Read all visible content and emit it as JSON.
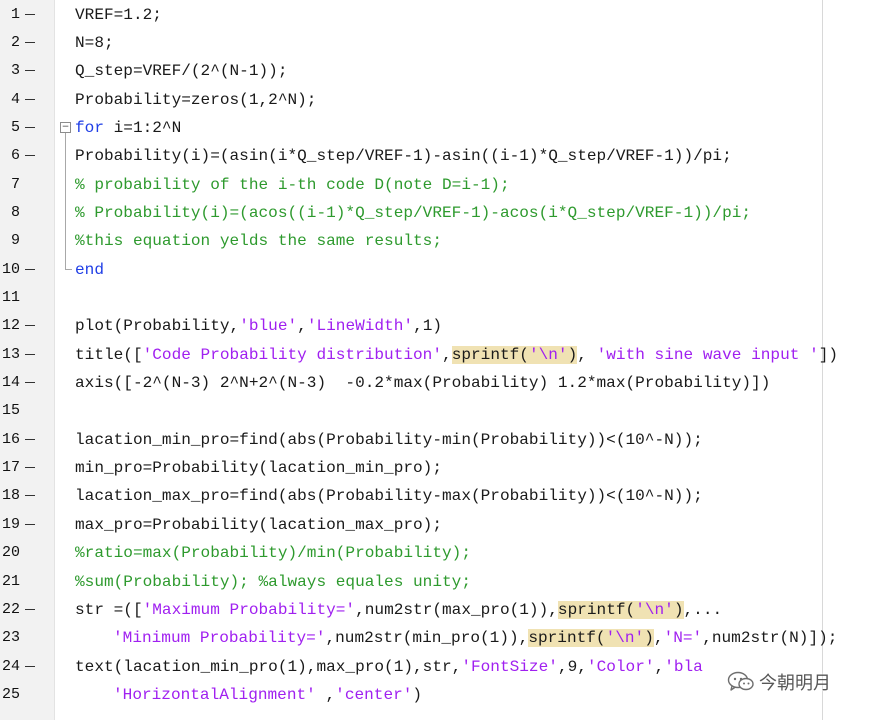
{
  "editor": {
    "lines": [
      {
        "num": "1",
        "dash": true,
        "indent": false,
        "tokens": [
          {
            "t": "VREF=1.2;",
            "c": ""
          }
        ]
      },
      {
        "num": "2",
        "dash": true,
        "indent": false,
        "tokens": [
          {
            "t": "N=8;",
            "c": ""
          }
        ]
      },
      {
        "num": "3",
        "dash": true,
        "indent": false,
        "tokens": [
          {
            "t": "Q_step=VREF/(2^(N-1));",
            "c": ""
          }
        ]
      },
      {
        "num": "4",
        "dash": true,
        "indent": false,
        "tokens": [
          {
            "t": "Probability=zeros(1,2^N);",
            "c": ""
          }
        ]
      },
      {
        "num": "5",
        "dash": true,
        "indent": false,
        "tokens": [
          {
            "t": "for",
            "c": "kw"
          },
          {
            "t": " i=1:2^N",
            "c": ""
          }
        ]
      },
      {
        "num": "6",
        "dash": true,
        "indent": false,
        "tokens": [
          {
            "t": "Probability(i)=(asin(i*Q_step/VREF-1)-asin((i-1)*Q_step/VREF-1))/pi;",
            "c": ""
          }
        ]
      },
      {
        "num": "7",
        "dash": false,
        "indent": false,
        "tokens": [
          {
            "t": "% probability of the i-th code D(note D=i-1);",
            "c": "cm"
          }
        ]
      },
      {
        "num": "8",
        "dash": false,
        "indent": false,
        "tokens": [
          {
            "t": "% Probability(i)=(acos((i-1)*Q_step/VREF-1)-acos(i*Q_step/VREF-1))/pi;",
            "c": "cm"
          }
        ]
      },
      {
        "num": "9",
        "dash": false,
        "indent": false,
        "tokens": [
          {
            "t": "%this equation yelds the same results;",
            "c": "cm"
          }
        ]
      },
      {
        "num": "10",
        "dash": true,
        "indent": false,
        "tokens": [
          {
            "t": "end",
            "c": "kw"
          }
        ]
      },
      {
        "num": "11",
        "dash": false,
        "indent": false,
        "tokens": []
      },
      {
        "num": "12",
        "dash": true,
        "indent": false,
        "tokens": [
          {
            "t": "plot(Probability,",
            "c": ""
          },
          {
            "t": "'blue'",
            "c": "str"
          },
          {
            "t": ",",
            "c": ""
          },
          {
            "t": "'LineWidth'",
            "c": "str"
          },
          {
            "t": ",1)",
            "c": ""
          }
        ]
      },
      {
        "num": "13",
        "dash": true,
        "indent": false,
        "tokens": [
          {
            "t": "title([",
            "c": ""
          },
          {
            "t": "'Code Probability distribution'",
            "c": "str"
          },
          {
            "t": ",",
            "c": ""
          },
          {
            "t": "sprintf(",
            "c": "hl"
          },
          {
            "t": "'\\n'",
            "c": "str hl"
          },
          {
            "t": ")",
            "c": "hl"
          },
          {
            "t": ", ",
            "c": ""
          },
          {
            "t": "'with sine wave input '",
            "c": "str"
          },
          {
            "t": "])",
            "c": ""
          }
        ]
      },
      {
        "num": "14",
        "dash": true,
        "indent": false,
        "tokens": [
          {
            "t": "axis([-2^(N-3) 2^N+2^(N-3)  -0.2*max(Probability) 1.2*max(Probability)])",
            "c": ""
          }
        ]
      },
      {
        "num": "15",
        "dash": false,
        "indent": false,
        "tokens": []
      },
      {
        "num": "16",
        "dash": true,
        "indent": false,
        "tokens": [
          {
            "t": "lacation_min_pro=find(abs(Probability-min(Probability))<(10^-N));",
            "c": ""
          }
        ]
      },
      {
        "num": "17",
        "dash": true,
        "indent": false,
        "tokens": [
          {
            "t": "min_pro=Probability(lacation_min_pro);",
            "c": ""
          }
        ]
      },
      {
        "num": "18",
        "dash": true,
        "indent": false,
        "tokens": [
          {
            "t": "lacation_max_pro=find(abs(Probability-max(Probability))<(10^-N));",
            "c": ""
          }
        ]
      },
      {
        "num": "19",
        "dash": true,
        "indent": false,
        "tokens": [
          {
            "t": "max_pro=Probability(lacation_max_pro);",
            "c": ""
          }
        ]
      },
      {
        "num": "20",
        "dash": false,
        "indent": false,
        "tokens": [
          {
            "t": "%ratio=max(Probability)/min(Probability);",
            "c": "cm"
          }
        ]
      },
      {
        "num": "21",
        "dash": false,
        "indent": false,
        "tokens": [
          {
            "t": "%sum(Probability); %always equales unity;",
            "c": "cm"
          }
        ]
      },
      {
        "num": "22",
        "dash": true,
        "indent": false,
        "tokens": [
          {
            "t": "str =([",
            "c": ""
          },
          {
            "t": "'Maximum Probability='",
            "c": "str"
          },
          {
            "t": ",num2str(max_pro(1)),",
            "c": ""
          },
          {
            "t": "sprintf(",
            "c": "hl"
          },
          {
            "t": "'\\n'",
            "c": "str hl"
          },
          {
            "t": ")",
            "c": "hl"
          },
          {
            "t": ",...",
            "c": ""
          }
        ]
      },
      {
        "num": "23",
        "dash": false,
        "indent": true,
        "tokens": [
          {
            "t": "'Minimum Probability='",
            "c": "str"
          },
          {
            "t": ",num2str(min_pro(1)),",
            "c": ""
          },
          {
            "t": "sprintf(",
            "c": "hl"
          },
          {
            "t": "'\\n'",
            "c": "str hl"
          },
          {
            "t": ")",
            "c": "hl"
          },
          {
            "t": ",",
            "c": ""
          },
          {
            "t": "'N='",
            "c": "str"
          },
          {
            "t": ",num2str(N)]);",
            "c": ""
          }
        ]
      },
      {
        "num": "24",
        "dash": true,
        "indent": false,
        "tokens": [
          {
            "t": "text(lacation_min_pro(1),max_pro(1),str,",
            "c": ""
          },
          {
            "t": "'FontSize'",
            "c": "str"
          },
          {
            "t": ",9,",
            "c": ""
          },
          {
            "t": "'Color'",
            "c": "str"
          },
          {
            "t": ",",
            "c": ""
          },
          {
            "t": "'bla",
            "c": "str"
          }
        ]
      },
      {
        "num": "25",
        "dash": false,
        "indent": true,
        "tokens": [
          {
            "t": "'HorizontalAlignment'",
            "c": "str"
          },
          {
            "t": " ,",
            "c": ""
          },
          {
            "t": "'center'",
            "c": "str"
          },
          {
            "t": ")",
            "c": ""
          }
        ]
      }
    ],
    "fold_symbol": "−"
  },
  "watermark": {
    "text": "今朝明月",
    "icon": "wechat-icon"
  }
}
